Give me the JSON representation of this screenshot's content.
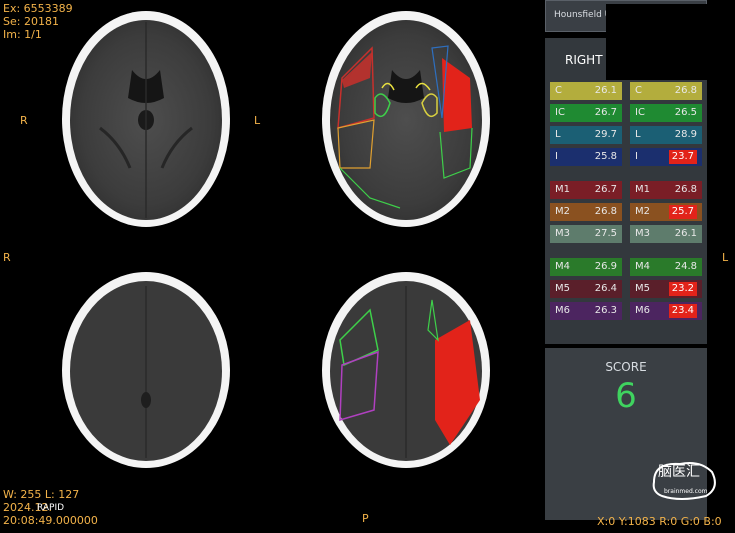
{
  "overlay": {
    "ex": "Ex: 6553389",
    "se": "Se: 20181",
    "im": "Im: 1/1",
    "r_marker_top": "R",
    "l_marker_top": "L",
    "r_marker_mid": "R",
    "l_marker_mid": "L",
    "p_marker": "P",
    "window": "W: 255 L: 127",
    "date": "2024.12.",
    "rapid": "RAPID",
    "time": "20:08:49.000000"
  },
  "panel": {
    "hu_label": "Hounsfield U",
    "right_label": "RIGHT",
    "score_label": "SCORE",
    "score_value": "6",
    "coords": "X:0 Y:1083 R:0 G:0 B:0"
  },
  "regions": [
    {
      "label": "C",
      "right": "26.1",
      "left": "26.8",
      "left_flag": false,
      "rc": "#b3ad3d",
      "lc": "#b3ad3d"
    },
    {
      "label": "IC",
      "right": "26.7",
      "left": "26.5",
      "left_flag": false,
      "rc": "#1f8a32",
      "lc": "#1f8a32"
    },
    {
      "label": "L",
      "right": "29.7",
      "left": "28.9",
      "left_flag": false,
      "rc": "#1b5f74",
      "lc": "#1b5f74"
    },
    {
      "label": "I",
      "right": "25.8",
      "left": "23.7",
      "left_flag": true,
      "rc": "#1b2f6e",
      "lc": "#1b2f6e"
    },
    {
      "label": "M1",
      "right": "26.7",
      "left": "26.8",
      "left_flag": false,
      "rc": "#7a1e26",
      "lc": "#7a1e26"
    },
    {
      "label": "M2",
      "right": "26.8",
      "left": "25.7",
      "left_flag": true,
      "rc": "#8a5120",
      "lc": "#8a5120"
    },
    {
      "label": "M3",
      "right": "27.5",
      "left": "26.1",
      "left_flag": false,
      "rc": "#5e7c6c",
      "lc": "#5e7c6c"
    },
    {
      "label": "M4",
      "right": "26.9",
      "left": "24.8",
      "left_flag": false,
      "rc": "#2a7a2a",
      "lc": "#2a7a2a"
    },
    {
      "label": "M5",
      "right": "26.4",
      "left": "23.2",
      "left_flag": true,
      "rc": "#5a1f2a",
      "lc": "#5a1f2a"
    },
    {
      "label": "M6",
      "right": "26.3",
      "left": "23.4",
      "left_flag": true,
      "rc": "#4c2560",
      "lc": "#4c2560"
    }
  ],
  "logo": {
    "text": "脑医汇",
    "sub": "brainmed.com"
  },
  "colors": {
    "overlay": "#f3b34a",
    "score": "#3fd35f",
    "flag": "#e2231a",
    "region_red": "#e2231a"
  }
}
